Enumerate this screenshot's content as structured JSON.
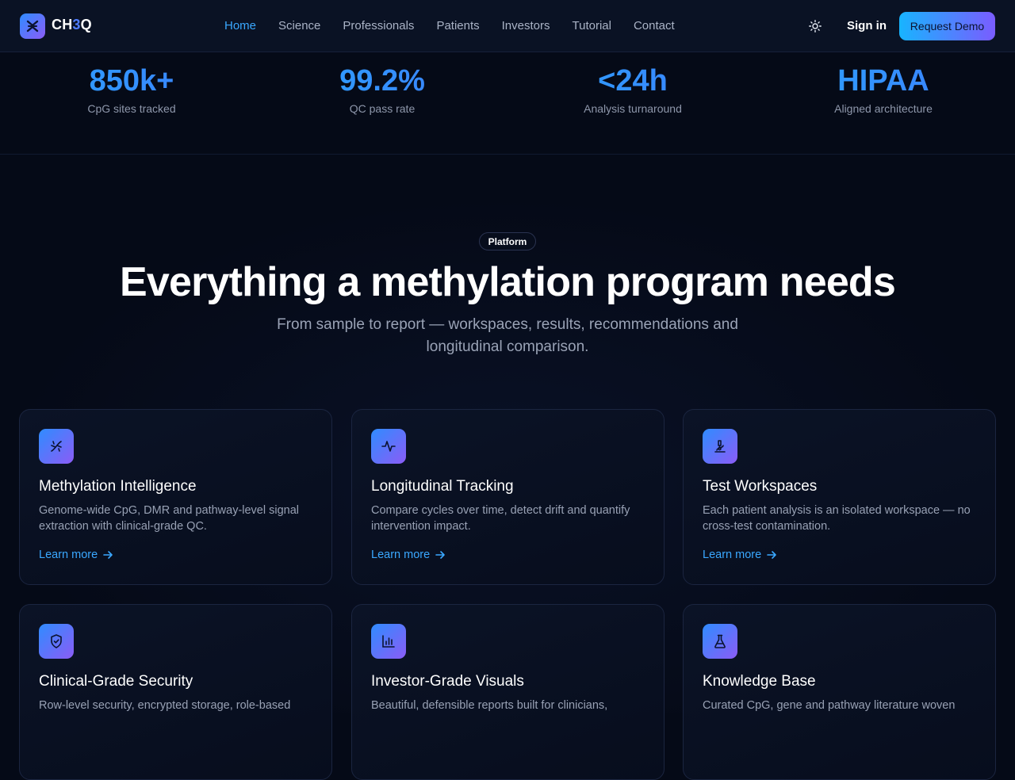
{
  "nav": {
    "logo": {
      "prefix": "CH",
      "accent": "3",
      "suffix": "Q"
    },
    "links": [
      "Home",
      "Science",
      "Professionals",
      "Patients",
      "Investors",
      "Tutorial",
      "Contact"
    ],
    "active": "Home",
    "theme_icon": "sun-icon",
    "signin_label": "Sign in",
    "demo_label": "Request Demo"
  },
  "stats": [
    {
      "value": "850k+",
      "label": "CpG sites tracked"
    },
    {
      "value": "99.2%",
      "label": "QC pass rate"
    },
    {
      "value": "<24h",
      "label": "Analysis turnaround"
    },
    {
      "value": "HIPAA",
      "label": "Aligned architecture"
    }
  ],
  "hero": {
    "badge": "Platform",
    "title": "Everything a methylation program needs",
    "subtitle": "From sample to report — workspaces, results, recommendations and longitudinal comparison."
  },
  "cards": [
    {
      "icon": "dna-icon",
      "title": "Methylation Intelligence",
      "desc": "Genome-wide CpG, DMR and pathway-level signal extraction with clinical-grade QC.",
      "link": "Learn more"
    },
    {
      "icon": "activity-icon",
      "title": "Longitudinal Tracking",
      "desc": "Compare cycles over time, detect drift and quantify intervention impact.",
      "link": "Learn more"
    },
    {
      "icon": "microscope-icon",
      "title": "Test Workspaces",
      "desc": "Each patient analysis is an isolated workspace — no cross-test contamination.",
      "link": "Learn more"
    },
    {
      "icon": "shield-check-icon",
      "title": "Clinical-Grade Security",
      "desc": "Row-level security, encrypted storage, role-based",
      "link": ""
    },
    {
      "icon": "bar-chart-icon",
      "title": "Investor-Grade Visuals",
      "desc": "Beautiful, defensible reports built for clinicians,",
      "link": ""
    },
    {
      "icon": "flask-icon",
      "title": "Knowledge Base",
      "desc": "Curated CpG, gene and pathway literature woven",
      "link": ""
    }
  ],
  "colors": {
    "background": "#050a17",
    "accent_blue": "#3aa8ff",
    "gradient_start": "#2f8cff",
    "gradient_end": "#8b5cf6"
  }
}
